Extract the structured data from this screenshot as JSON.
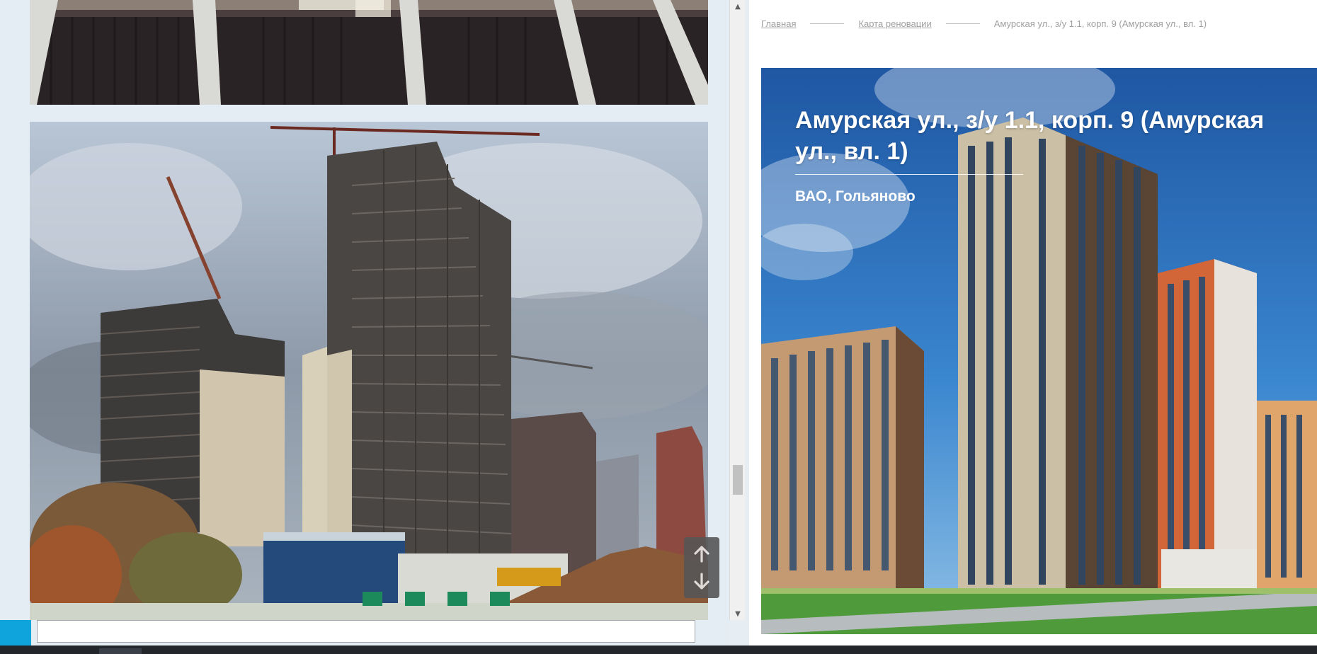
{
  "breadcrumb": {
    "home": "Главная",
    "map": "Карта реновации",
    "current": "Амурская ул., з/у 1.1, корп. 9 (Амурская ул., вл. 1)"
  },
  "hero": {
    "title": "Амурская ул., з/у 1.1, корп. 9 (Амурская ул., вл. 1)",
    "district": "ВАО, Гольяново"
  },
  "photo_nav": {
    "up_icon": "arrow-up-icon",
    "down_icon": "arrow-down-icon"
  },
  "colors": {
    "accent": "#0fa4dc",
    "sky": "#2c6db8"
  }
}
